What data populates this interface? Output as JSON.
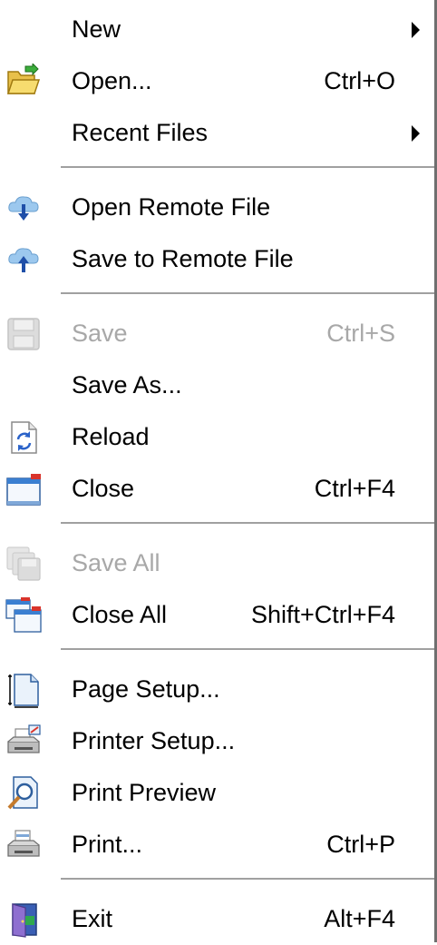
{
  "menu": {
    "items": [
      {
        "label": "New",
        "shortcut": "",
        "submenu": true,
        "icon": "none",
        "disabled": false
      },
      {
        "label": "Open...",
        "shortcut": "Ctrl+O",
        "submenu": false,
        "icon": "open-folder-icon",
        "disabled": false
      },
      {
        "label": "Recent Files",
        "shortcut": "",
        "submenu": true,
        "icon": "none",
        "disabled": false
      },
      {
        "label": "Open Remote File",
        "shortcut": "",
        "submenu": false,
        "icon": "cloud-download-icon",
        "disabled": false
      },
      {
        "label": "Save to Remote File",
        "shortcut": "",
        "submenu": false,
        "icon": "cloud-upload-icon",
        "disabled": false
      },
      {
        "label": "Save",
        "shortcut": "Ctrl+S",
        "submenu": false,
        "icon": "floppy-disk-icon",
        "disabled": true
      },
      {
        "label": "Save As...",
        "shortcut": "",
        "submenu": false,
        "icon": "none",
        "disabled": false
      },
      {
        "label": "Reload",
        "shortcut": "",
        "submenu": false,
        "icon": "reload-document-icon",
        "disabled": false
      },
      {
        "label": "Close",
        "shortcut": "Ctrl+F4",
        "submenu": false,
        "icon": "close-window-icon",
        "disabled": false
      },
      {
        "label": "Save All",
        "shortcut": "",
        "submenu": false,
        "icon": "save-all-icon",
        "disabled": true
      },
      {
        "label": "Close All",
        "shortcut": "Shift+Ctrl+F4",
        "submenu": false,
        "icon": "close-all-windows-icon",
        "disabled": false
      },
      {
        "label": "Page Setup...",
        "shortcut": "",
        "submenu": false,
        "icon": "page-setup-icon",
        "disabled": false
      },
      {
        "label": "Printer Setup...",
        "shortcut": "",
        "submenu": false,
        "icon": "printer-setup-icon",
        "disabled": false
      },
      {
        "label": "Print Preview",
        "shortcut": "",
        "submenu": false,
        "icon": "print-preview-icon",
        "disabled": false
      },
      {
        "label": "Print...",
        "shortcut": "Ctrl+P",
        "submenu": false,
        "icon": "printer-icon",
        "disabled": false
      },
      {
        "label": "Exit",
        "shortcut": "Alt+F4",
        "submenu": false,
        "icon": "exit-door-icon",
        "disabled": false
      }
    ]
  },
  "colors": {
    "text": "#000000",
    "disabled_text": "#a8a8a8",
    "separator": "#a0a0a0",
    "background": "#ffffff"
  }
}
